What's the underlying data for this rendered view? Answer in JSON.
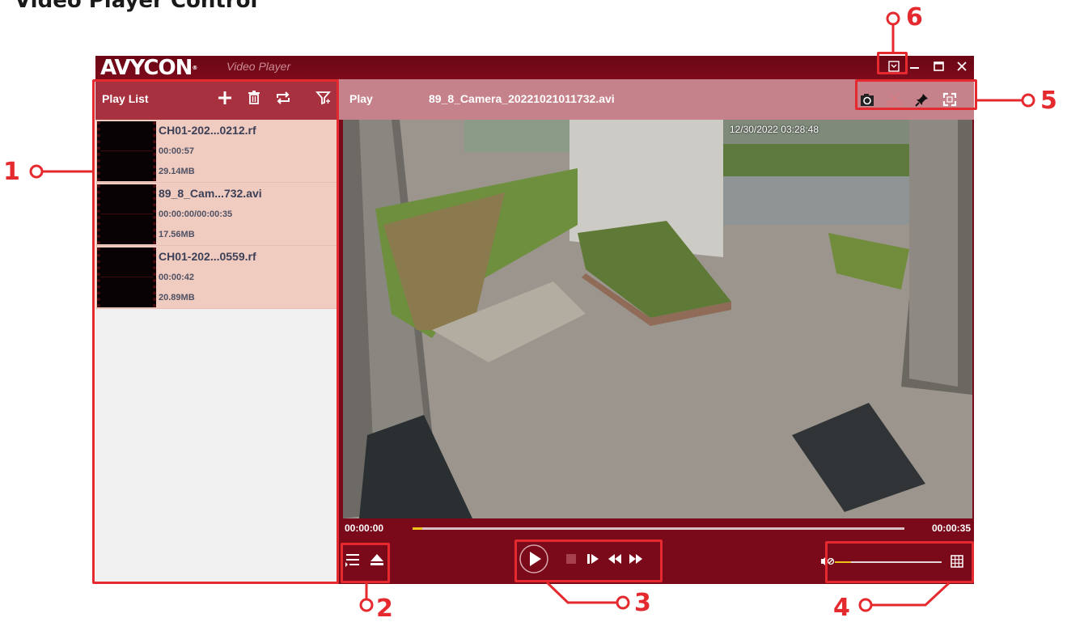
{
  "doc": {
    "heading": "Video Player Control"
  },
  "app": {
    "brand": "AVYCON",
    "brand_mark": "®",
    "subtitle": "Video Player"
  },
  "sidebar": {
    "title": "Play List",
    "items": [
      {
        "name": "CH01-202...0212.rf",
        "duration": "00:00:57",
        "size": "29.14MB"
      },
      {
        "name": "89_8_Cam...732.avi",
        "duration": "00:00:00/00:00:35",
        "size": "17.56MB"
      },
      {
        "name": "CH01-202...0559.rf",
        "duration": "00:00:42",
        "size": "20.89MB"
      }
    ]
  },
  "main": {
    "label": "Play",
    "file": "89_8_Camera_20221021011732.avi",
    "timestamp": "12/30/2022 03:28:48"
  },
  "playback": {
    "time_start": "00:00:00",
    "time_end": "00:00:35",
    "progress": 0.02,
    "volume": 0.15
  },
  "annotations": {
    "n1": "1",
    "n2": "2",
    "n3": "3",
    "n4": "4",
    "n5": "5",
    "n6": "6"
  },
  "colors": {
    "annotation": "#e52a2f",
    "accent": "#f0c419",
    "window": "#7a0a1a"
  }
}
